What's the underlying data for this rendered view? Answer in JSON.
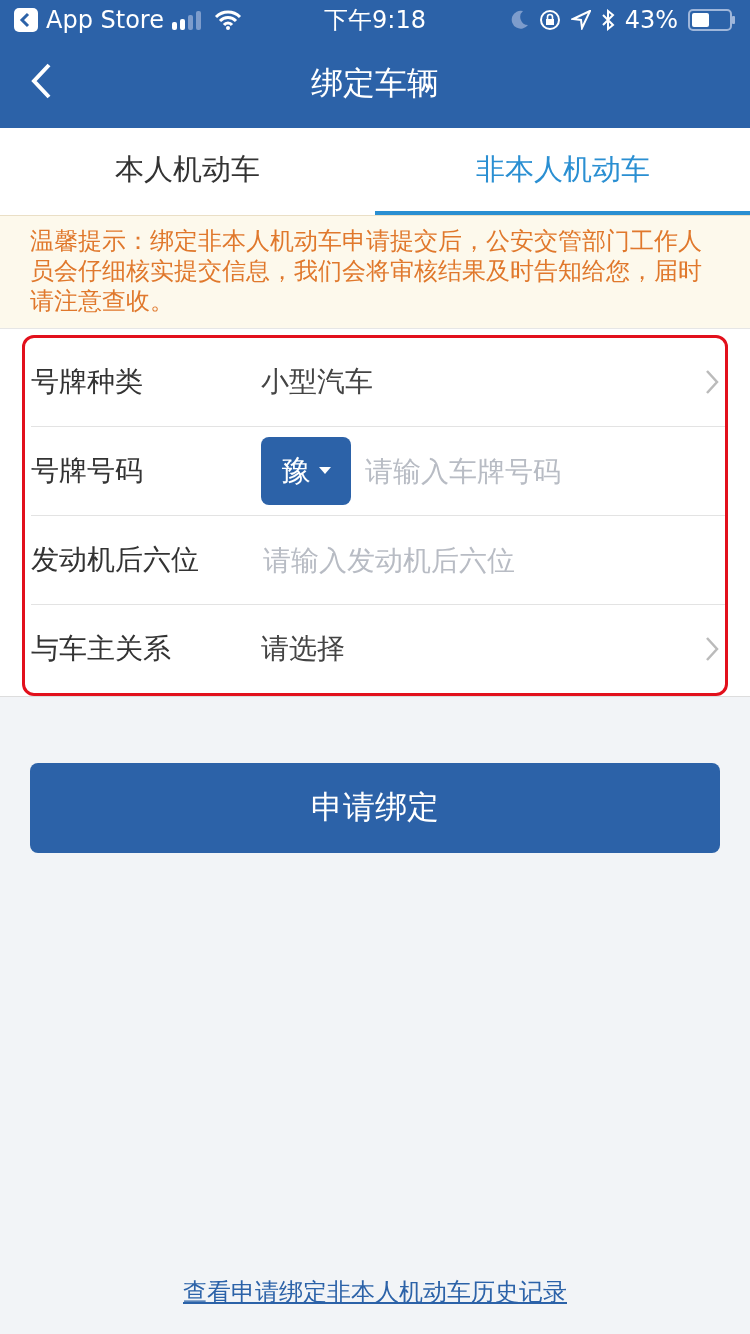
{
  "status_bar": {
    "back_app": "App Store",
    "time": "下午9:18",
    "battery": "43%"
  },
  "nav": {
    "title": "绑定车辆"
  },
  "tabs": [
    {
      "label": "本人机动车",
      "selected": false
    },
    {
      "label": "非本人机动车",
      "selected": true
    }
  ],
  "notice": "温馨提示：绑定非本人机动车申请提交后，公安交管部门工作人员会仔细核实提交信息，我们会将审核结果及时告知给您，届时请注意查收。",
  "form": {
    "highlighted": true,
    "rows": [
      {
        "kind": "select",
        "label": "号牌种类",
        "value": "小型汽车"
      },
      {
        "kind": "plate",
        "label": "号牌号码",
        "province": "豫",
        "placeholder": "请输入车牌号码"
      },
      {
        "kind": "input",
        "label": "发动机后六位",
        "placeholder": "请输入发动机后六位"
      },
      {
        "kind": "select",
        "label": "与车主关系",
        "value": "请选择"
      }
    ]
  },
  "submit": "申请绑定",
  "history_link": "查看申请绑定非本人机动车历史记录"
}
